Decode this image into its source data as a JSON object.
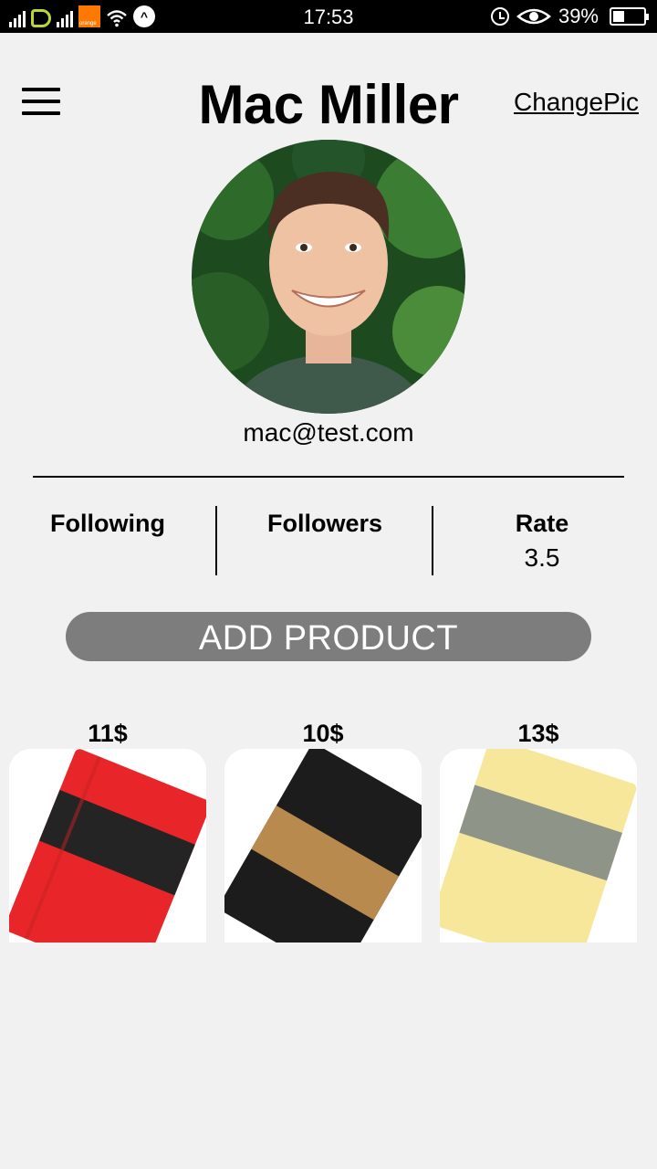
{
  "status_bar": {
    "time": "17:53",
    "battery_percent": "39%",
    "battery_level": 0.39,
    "icons": [
      "signal-icon",
      "carrier-icon",
      "signal-icon",
      "orange-logo-icon",
      "wifi-icon",
      "nfc-icon",
      "alarm-icon",
      "eye-comfort-icon",
      "battery-icon"
    ],
    "orange_label": "orange"
  },
  "header": {
    "menu_icon": "hamburger-menu-icon",
    "title": "Mac Miller",
    "change_pic_label": "ChangePic"
  },
  "profile": {
    "email": "mac@test.com"
  },
  "stats": [
    {
      "label": "Following",
      "value": ""
    },
    {
      "label": "Followers",
      "value": ""
    },
    {
      "label": "Rate",
      "value": "3.5"
    }
  ],
  "add_product_label": "ADD PRODUCT",
  "products": [
    {
      "price": "11$",
      "color": "#e8262a"
    },
    {
      "price": "10$",
      "color": "#1c1c1c"
    },
    {
      "price": "13$",
      "color": "#f7e79a"
    }
  ],
  "colors": {
    "background": "#f1f1f1",
    "button": "#7d7d7d",
    "status_bar": "#000000"
  }
}
